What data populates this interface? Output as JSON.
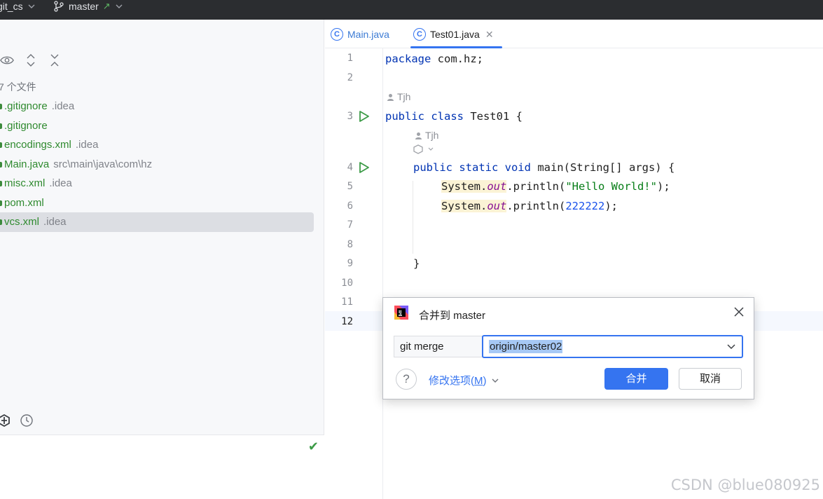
{
  "topbar": {
    "project": "git_cs",
    "branch": "master"
  },
  "left_panel": {
    "file_count": "7 个文件",
    "files": [
      {
        "name": ".gitignore",
        "path": ".idea"
      },
      {
        "name": ".gitignore",
        "path": ""
      },
      {
        "name": "encodings.xml",
        "path": ".idea"
      },
      {
        "name": "Main.java",
        "path": "src\\main\\java\\com\\hz"
      },
      {
        "name": "misc.xml",
        "path": ".idea"
      },
      {
        "name": "pom.xml",
        "path": ""
      },
      {
        "name": "vcs.xml",
        "path": ".idea"
      }
    ]
  },
  "tabs": [
    {
      "label": "Main.java",
      "icon": "class-icon"
    },
    {
      "label": "Test01.java",
      "icon": "class-icon",
      "active": true
    }
  ],
  "editor": {
    "line_numbers": [
      "1",
      "2",
      "3",
      "4",
      "5",
      "6",
      "7",
      "8",
      "9",
      "10",
      "11",
      "12"
    ],
    "author_hint": "Tjh",
    "code": {
      "l1_kw": "package",
      "l1_rest": " com.hz;",
      "l3_kw": "public class",
      "l3_rest": " Test01 {",
      "l4_kw": "public static void",
      "l4_rest": " main(String[] args) {",
      "l5_sys": "System.",
      "l5_out": "out",
      "l5_call": ".println(",
      "l5_str": "\"Hello World!\"",
      "l5_end": ");",
      "l6_sys": "System.",
      "l6_out": "out",
      "l6_call": ".println(",
      "l6_num": "222222",
      "l6_end": ");",
      "l9": "}"
    }
  },
  "dialog": {
    "title": "合并到 master",
    "command": "git merge",
    "branch_value": "origin/master02",
    "options_label": "修改选项(",
    "options_mnemonic": "M",
    "options_close": ")",
    "help": "?",
    "merge_button": "合并",
    "cancel_button": "取消"
  },
  "watermark": "CSDN @blue080925",
  "colors": {
    "accent": "#3574f0",
    "vcs_added": "#2f8a2f",
    "run_green": "#3c9b47"
  }
}
